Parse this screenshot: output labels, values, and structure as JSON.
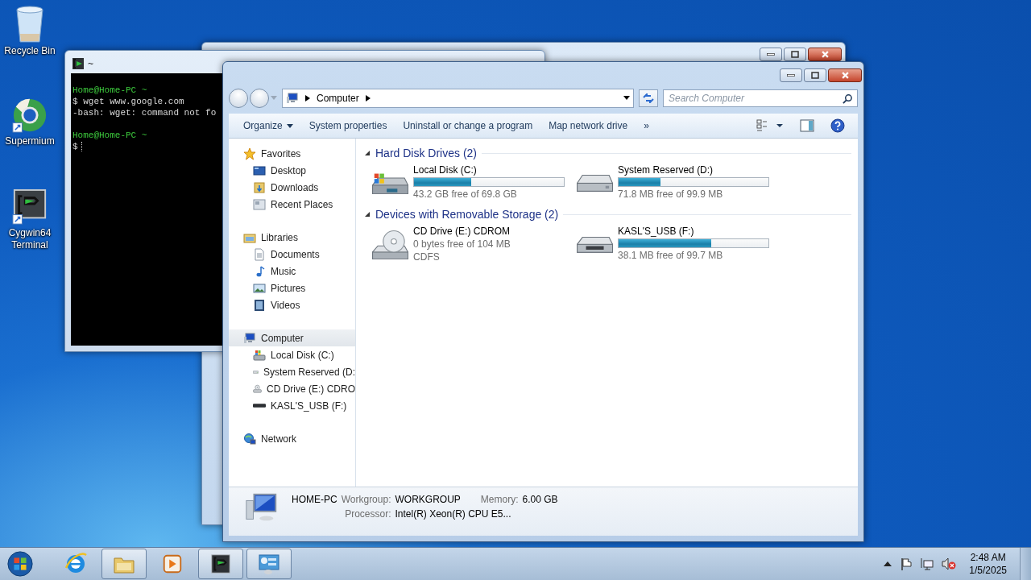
{
  "desktop_icons": [
    {
      "label": "Recycle Bin",
      "kind": "recycle"
    },
    {
      "label": "Supermium",
      "kind": "browser"
    },
    {
      "label": "Cygwin64 Terminal",
      "kind": "terminal"
    }
  ],
  "terminal": {
    "title": "~",
    "lines": [
      {
        "text": "Home@Home-PC ~",
        "kind": "prompt"
      },
      {
        "text": "$ wget www.google.com",
        "kind": "output"
      },
      {
        "text": "-bash: wget: command not fo",
        "kind": "output"
      },
      {
        "text": "Home@Home-PC ~",
        "kind": "prompt"
      },
      {
        "text": "$",
        "kind": "input"
      }
    ]
  },
  "explorer": {
    "address": [
      "Computer"
    ],
    "search": {
      "placeholder": "Search Computer"
    },
    "commands": [
      {
        "label": "Organize",
        "kind": "menu"
      },
      {
        "label": "System properties",
        "kind": "plain"
      },
      {
        "label": "Uninstall or change a program",
        "kind": "plain"
      },
      {
        "label": "Map network drive",
        "kind": "plain"
      },
      {
        "label": "»",
        "kind": "more"
      }
    ],
    "nav": [
      {
        "label": "Favorites",
        "kind": "star",
        "selected": false,
        "children": [
          {
            "label": "Desktop",
            "kind": "desktop",
            "selected": false
          },
          {
            "label": "Downloads",
            "kind": "downloads",
            "selected": false
          },
          {
            "label": "Recent Places",
            "kind": "recent",
            "selected": false
          }
        ]
      },
      {
        "label": "Libraries",
        "kind": "library",
        "selected": false,
        "children": [
          {
            "label": "Documents",
            "kind": "document",
            "selected": false
          },
          {
            "label": "Music",
            "kind": "music",
            "selected": false
          },
          {
            "label": "Pictures",
            "kind": "pictures",
            "selected": false
          },
          {
            "label": "Videos",
            "kind": "videos",
            "selected": false
          }
        ]
      },
      {
        "label": "Computer",
        "kind": "computer",
        "selected": true,
        "children": [
          {
            "label": "Local Disk (C:)",
            "kind": "windisk",
            "selected": false
          },
          {
            "label": "System Reserved (D:",
            "kind": "disk",
            "selected": false
          },
          {
            "label": "CD Drive (E:) CDRO",
            "kind": "cd",
            "selected": false
          },
          {
            "label": "KASL'S_USB (F:)",
            "kind": "usb",
            "selected": false
          }
        ]
      },
      {
        "label": "Network",
        "kind": "network",
        "selected": false
      }
    ],
    "groups": [
      {
        "title": "Hard Disk Drives (2)",
        "expanded": true,
        "items": [
          {
            "name": "Local Disk (C:)",
            "kind": "windisk",
            "level": 0.38,
            "free": "43.2 GB free of 69.8 GB"
          },
          {
            "name": "System Reserved (D:)",
            "kind": "disk",
            "level": 0.28,
            "free": "71.8 MB free of 99.9 MB"
          }
        ]
      },
      {
        "title": "Devices with Removable Storage (2)",
        "expanded": true,
        "items": [
          {
            "name": "CD Drive (E:) CDROM",
            "kind": "cd",
            "free": "0 bytes free of 104 MB",
            "filesystem": "CDFS"
          },
          {
            "name": "KASL'S_USB (F:)",
            "kind": "usb",
            "level": 0.62,
            "free": "38.1 MB free of 99.7 MB"
          }
        ]
      }
    ],
    "details": {
      "name": "HOME-PC",
      "fields": [
        {
          "label": "Workgroup:",
          "value": "WORKGROUP"
        },
        {
          "label": "Memory:",
          "value": "6.00 GB"
        },
        {
          "label": "Processor:",
          "value": "Intel(R) Xeon(R) CPU E5..."
        }
      ]
    }
  },
  "taskbar": {
    "buttons": [
      {
        "kind": "ie",
        "running": false
      },
      {
        "kind": "folder",
        "running": true
      },
      {
        "kind": "media",
        "running": false
      },
      {
        "kind": "terminal",
        "running": true
      },
      {
        "kind": "panel",
        "running": true
      }
    ],
    "clock": {
      "time": "2:48 AM",
      "date": "1/5/2025"
    }
  }
}
